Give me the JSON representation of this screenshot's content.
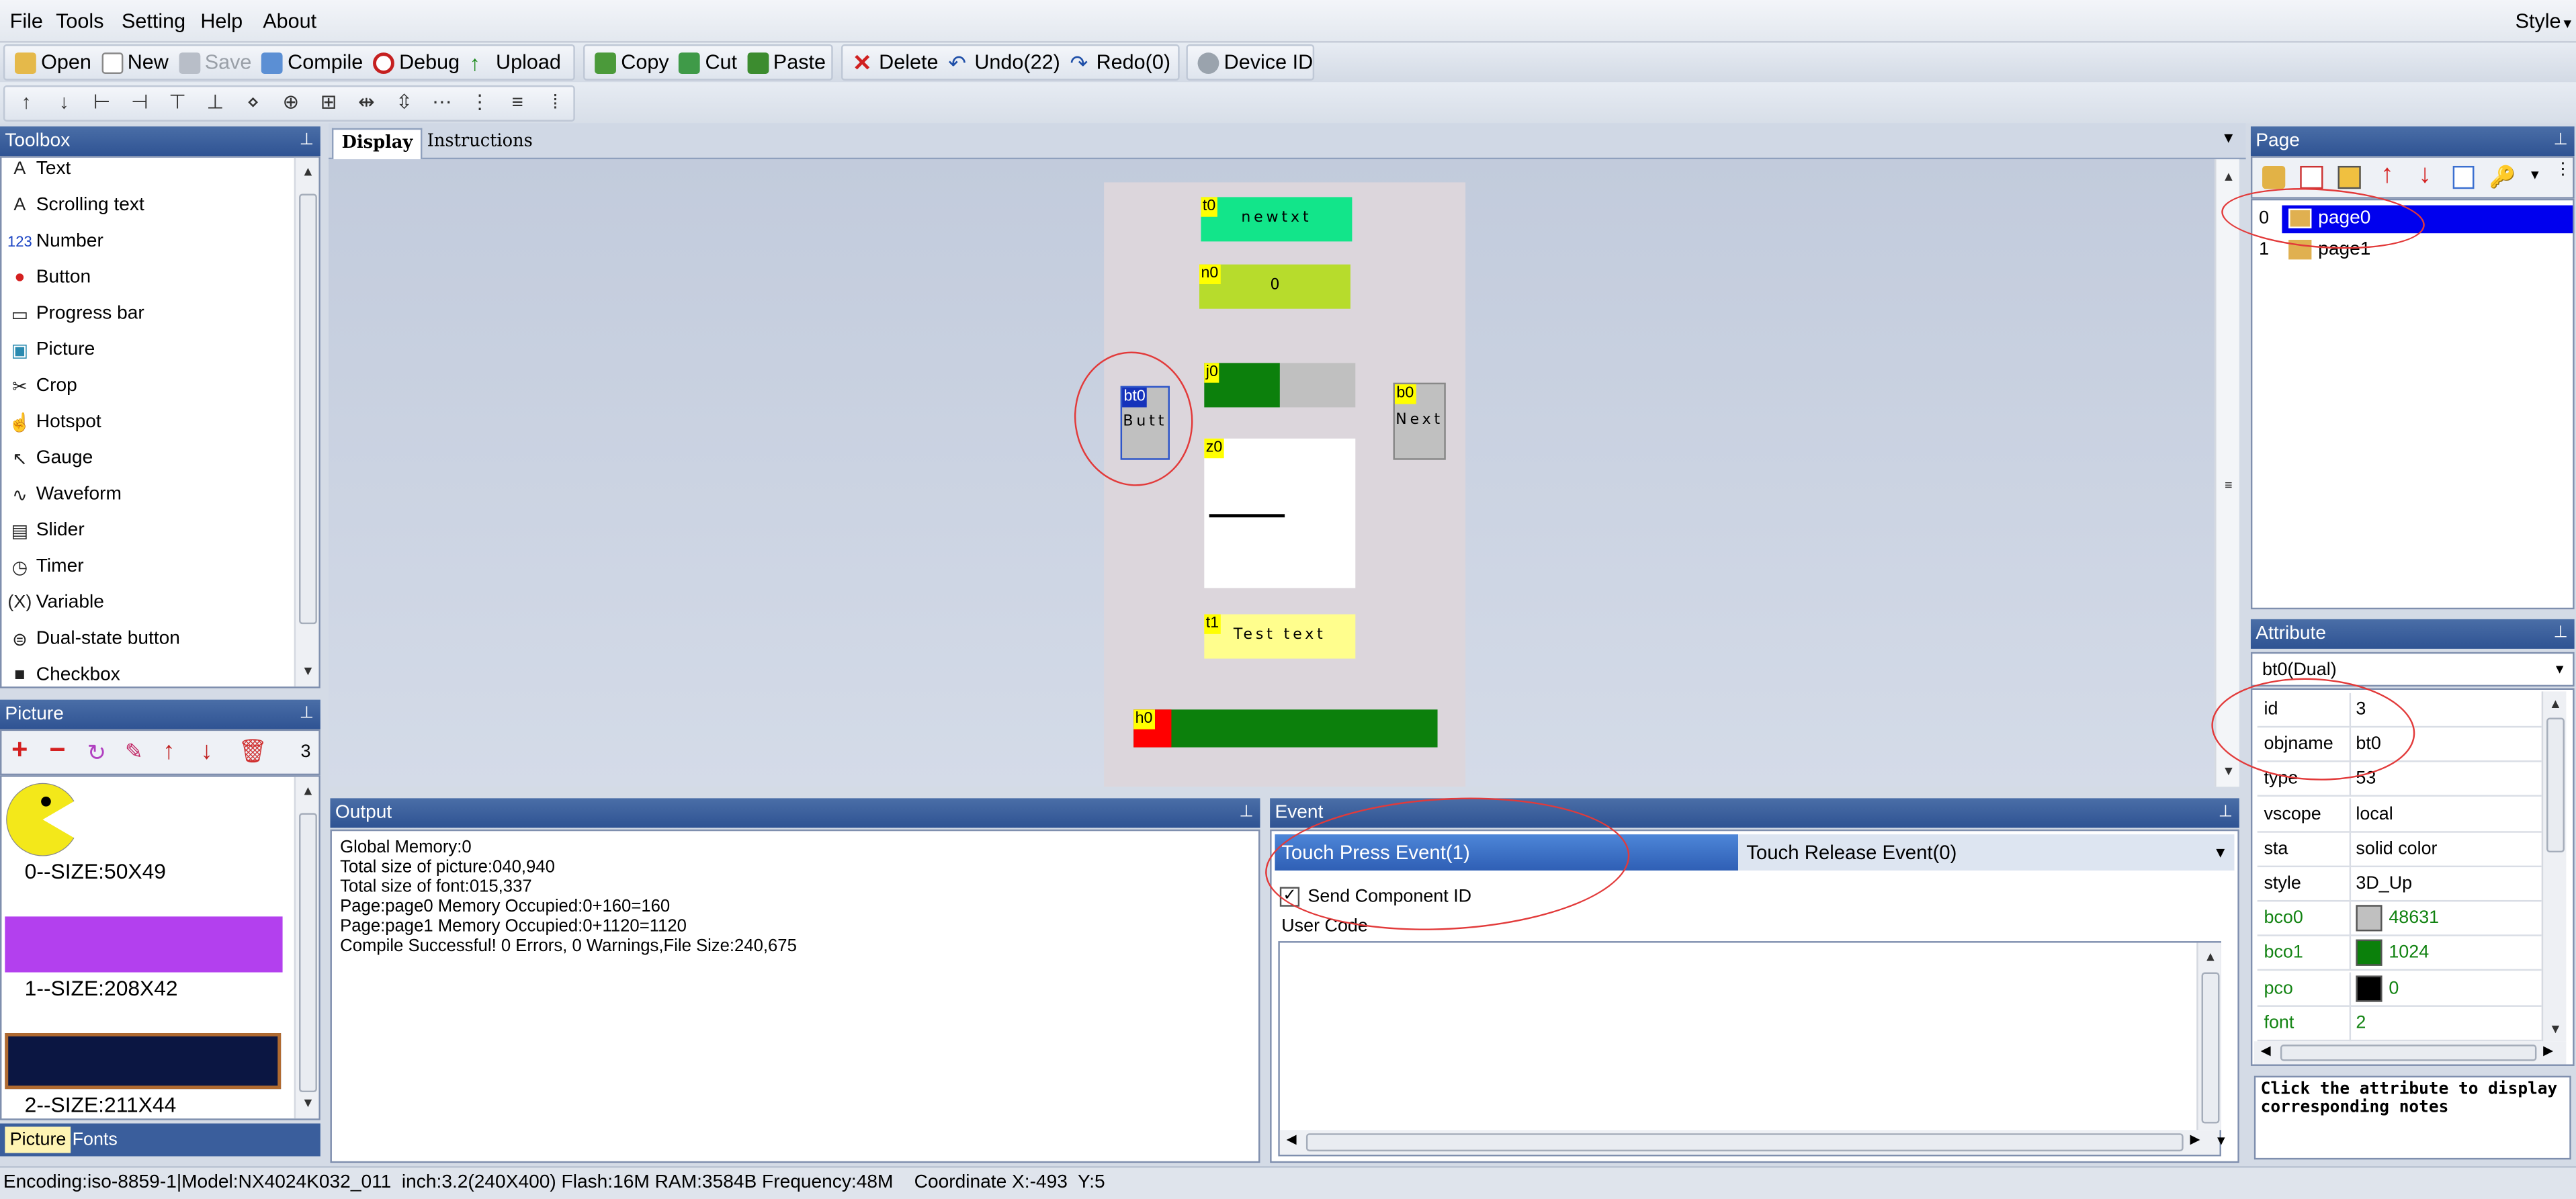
{
  "menu": [
    "File",
    "Tools",
    "Setting",
    "Help",
    "About"
  ],
  "style_menu": "Style",
  "toolbar": {
    "open": "Open",
    "new": "New",
    "save": "Save",
    "compile": "Compile",
    "debug": "Debug",
    "upload": "Upload",
    "copy": "Copy",
    "cut": "Cut",
    "paste": "Paste",
    "delete": "Delete",
    "undo": "Undo(22)",
    "redo": "Redo(0)",
    "device_id": "Device  ID"
  },
  "toolbox": {
    "title": "Toolbox",
    "items": [
      {
        "label": "Text",
        "icon": "A"
      },
      {
        "label": "Scrolling text",
        "icon": "A"
      },
      {
        "label": "Number",
        "icon": "123"
      },
      {
        "label": "Button",
        "icon": "●"
      },
      {
        "label": "Progress bar",
        "icon": "▭"
      },
      {
        "label": "Picture",
        "icon": "▣"
      },
      {
        "label": "Crop",
        "icon": "✂"
      },
      {
        "label": "Hotspot",
        "icon": "☝"
      },
      {
        "label": "Gauge",
        "icon": "↖"
      },
      {
        "label": "Waveform",
        "icon": "∿"
      },
      {
        "label": "Slider",
        "icon": "▤"
      },
      {
        "label": "Timer",
        "icon": "◷"
      },
      {
        "label": "Variable",
        "icon": "(X)"
      },
      {
        "label": "Dual-state button",
        "icon": "⊜"
      },
      {
        "label": "Checkbox",
        "icon": "■"
      }
    ]
  },
  "picture_panel": {
    "title": "Picture",
    "count": "3",
    "items": [
      {
        "label": "0--SIZE:50X49"
      },
      {
        "label": "1--SIZE:208X42"
      },
      {
        "label": "2--SIZE:211X44"
      }
    ],
    "tabs": [
      "Picture",
      "Fonts"
    ]
  },
  "display_tabs": [
    "Display",
    "Instructions"
  ],
  "canvas": {
    "t0": {
      "tag": "t0",
      "text": "newtxt"
    },
    "n0": {
      "tag": "n0",
      "text": "0"
    },
    "bt0": {
      "tag": "bt0",
      "text": "Butt"
    },
    "j0": {
      "tag": "j0",
      "progress": 0.5
    },
    "b0": {
      "tag": "b0",
      "text": "Next"
    },
    "z0": {
      "tag": "z0"
    },
    "t1": {
      "tag": "t1",
      "text": "Test text"
    },
    "h0": {
      "tag": "h0"
    }
  },
  "page_panel": {
    "title": "Page",
    "pages": [
      {
        "index": "0",
        "name": "page0"
      },
      {
        "index": "1",
        "name": "page1"
      }
    ]
  },
  "attribute": {
    "title": "Attribute",
    "selected": "bt0(Dual)",
    "rows": [
      {
        "key": "id",
        "value": "3",
        "green": false
      },
      {
        "key": "objname",
        "value": "bt0",
        "green": false
      },
      {
        "key": "type",
        "value": "53",
        "green": false
      },
      {
        "key": "vscope",
        "value": "local",
        "green": false
      },
      {
        "key": "sta",
        "value": "solid color",
        "green": false
      },
      {
        "key": "style",
        "value": "3D_Up",
        "green": false
      },
      {
        "key": "bco0",
        "value": "48631",
        "green": true,
        "swatch": "#c0c0c0"
      },
      {
        "key": "bco1",
        "value": "1024",
        "green": true,
        "swatch": "#0b800b"
      },
      {
        "key": "pco",
        "value": "0",
        "green": true,
        "swatch": "#000000"
      },
      {
        "key": "font",
        "value": "2",
        "green": true
      }
    ],
    "note": "Click the attribute to display corresponding notes"
  },
  "output": {
    "title": "Output",
    "lines": [
      "Global Memory:0",
      "Total size of picture:040,940",
      "Total size of font:015,337",
      "Page:page0 Memory Occupied:0+160=160",
      "Page:page1 Memory Occupied:0+1120=1120",
      "Compile Successful! 0 Errors, 0 Warnings,File Size:240,675"
    ]
  },
  "event": {
    "title": "Event",
    "tab_press": "Touch Press Event(1)",
    "tab_release": "Touch Release Event(0)",
    "send_id": "Send Component ID",
    "user_code": "User Code"
  },
  "status": "Encoding:iso-8859-1|Model:NX4024K032_011  inch:3.2(240X400) Flash:16M RAM:3584B Frequency:48M    Coordinate X:-493  Y:5"
}
